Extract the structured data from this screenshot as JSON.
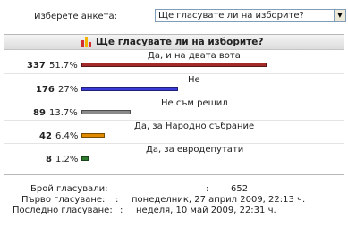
{
  "selector": {
    "label": "Изберете анкета:",
    "value": "Ще гласувате ли на изборите?"
  },
  "poll": {
    "title": "Ще гласувате ли на изборите?",
    "icon": "poll-chart-icon",
    "options": [
      {
        "label": "Да, и на двата вота",
        "count": "337",
        "percent": "51.7%",
        "share": 0.517,
        "color": "#a52a2a"
      },
      {
        "label": "Не",
        "count": "176",
        "percent": "27%",
        "share": 0.27,
        "color": "#3b3bd9"
      },
      {
        "label": "Не съм решил",
        "count": "89",
        "percent": "13.7%",
        "share": 0.137,
        "color": "#8a8a8a"
      },
      {
        "label": "Да, за Народно събрание",
        "count": "42",
        "percent": "6.4%",
        "share": 0.064,
        "color": "#e08a00"
      },
      {
        "label": "Да, за евродепутати",
        "count": "8",
        "percent": "1.2%",
        "share": 0.012,
        "color": "#2e7d2e"
      }
    ]
  },
  "stats": {
    "total_label": "Брой гласували:",
    "total_sep": ":",
    "total_value": "652",
    "first_label": "Първо гласуване:",
    "first_sep": ":",
    "first_value": "понеделник, 27 април 2009, 22:13 ч.",
    "last_label": "Последно гласуване:",
    "last_sep": ":",
    "last_value": "неделя, 10 май 2009, 22:31 ч."
  }
}
